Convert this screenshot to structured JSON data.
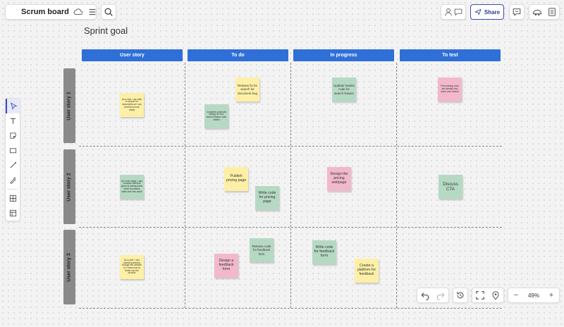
{
  "app": {
    "title": "Scrum board"
  },
  "toolbar": {
    "share_label": "Share"
  },
  "board": {
    "title": "Sprint goal",
    "columns": [
      "User story",
      "To do",
      "In progress",
      "To test"
    ],
    "rows": [
      "User story 1",
      "User story 2",
      "User story 3"
    ]
  },
  "notes": [
    {
      "text": "As a user, I am able to search for documents so I can find them more easily",
      "color": "yellow"
    },
    {
      "text": "Release fix for search for document bug",
      "color": "yellow"
    },
    {
      "text": "Complete automatic testing for new search feature code written",
      "color": "green"
    },
    {
      "text": "Update/ rewrite code for search feature",
      "color": "green"
    },
    {
      "text": "Find existing code and identify why users can't search",
      "color": "pink"
    },
    {
      "text": "As a site visitor, I can compare different types of pricing plans which increases sales and new users",
      "color": "green"
    },
    {
      "text": "Publish pricing page",
      "color": "yellow"
    },
    {
      "text": "Write code for pricing page",
      "color": "green"
    },
    {
      "text": "Design the pricing webpage",
      "color": "pink"
    },
    {
      "text": "Discuss CTA",
      "color": "green"
    },
    {
      "text": "As a user, I can submit questions through the website so I know how to better use the product",
      "color": "yellow"
    },
    {
      "text": "Release code for feedback form",
      "color": "green"
    },
    {
      "text": "Design a feedback form",
      "color": "pink"
    },
    {
      "text": "Write code for feedback form",
      "color": "green"
    },
    {
      "text": "Create a platform for feedback",
      "color": "yellow"
    }
  ],
  "zoom": {
    "level": "49%"
  },
  "colors": {
    "header_blue": "#2e6fd8",
    "row_gray": "#8a8a8a",
    "accent": "#3d4bb1"
  }
}
